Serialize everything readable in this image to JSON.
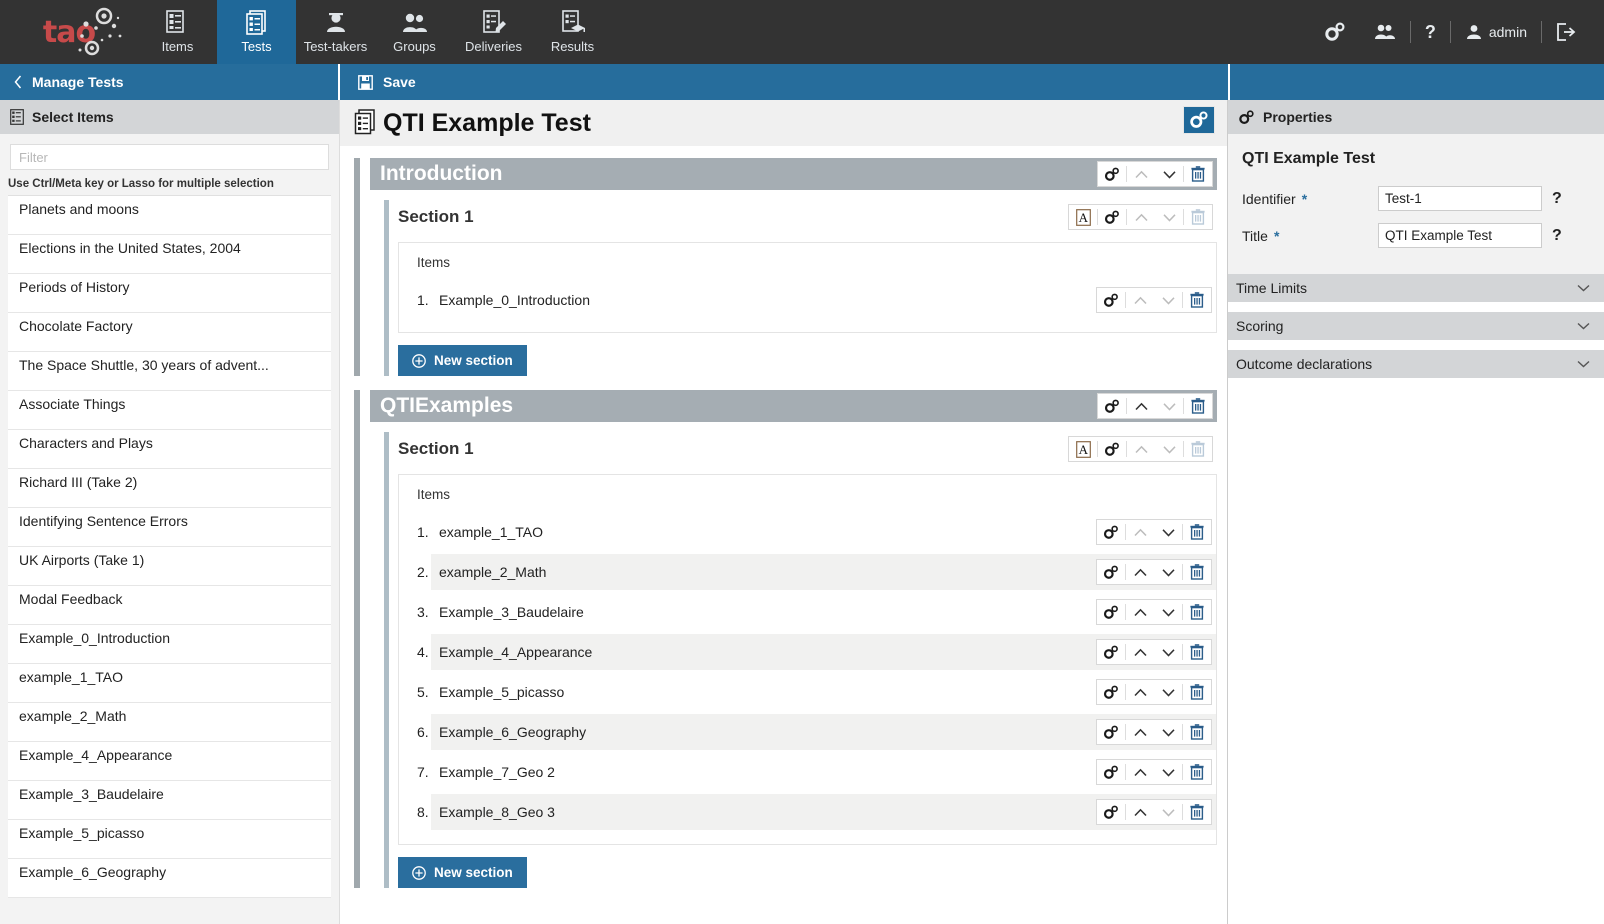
{
  "topnav": {
    "brand": "tao",
    "items": [
      {
        "label": "Items",
        "icon": "items-icon",
        "active": false
      },
      {
        "label": "Tests",
        "icon": "tests-icon",
        "active": true
      },
      {
        "label": "Test-takers",
        "icon": "testtakers-icon",
        "active": false
      },
      {
        "label": "Groups",
        "icon": "groups-icon",
        "active": false
      },
      {
        "label": "Deliveries",
        "icon": "deliveries-icon",
        "active": false
      },
      {
        "label": "Results",
        "icon": "results-icon",
        "active": false
      }
    ],
    "right": {
      "settings_icon": "gears-icon",
      "users_icon": "users-icon",
      "help_label": "?",
      "user_label": "admin",
      "logout_icon": "logout-icon"
    },
    "active_color": "#1f6899",
    "bg_color": "#333333"
  },
  "subbar": {
    "back_label": "Manage Tests",
    "save_label": "Save",
    "bg_color": "#266d9c"
  },
  "sidebar": {
    "header": "Select Items",
    "filter_placeholder": "Filter",
    "filter_value": "",
    "hint": "Use Ctrl/Meta key or Lasso for multiple selection",
    "items": [
      {
        "label": "Planets and moons"
      },
      {
        "label": "Elections in the United States, 2004"
      },
      {
        "label": "Periods of History"
      },
      {
        "label": "Chocolate Factory"
      },
      {
        "label": "The Space Shuttle, 30 years of advent..."
      },
      {
        "label": "Associate Things"
      },
      {
        "label": "Characters and Plays"
      },
      {
        "label": "Richard III (Take 2)"
      },
      {
        "label": "Identifying Sentence Errors"
      },
      {
        "label": "UK Airports (Take 1)"
      },
      {
        "label": "Modal Feedback"
      },
      {
        "label": "Example_0_Introduction"
      },
      {
        "label": "example_1_TAO"
      },
      {
        "label": "example_2_Math"
      },
      {
        "label": "Example_4_Appearance"
      },
      {
        "label": "Example_3_Baudelaire"
      },
      {
        "label": "Example_5_picasso"
      },
      {
        "label": "Example_6_Geography"
      }
    ]
  },
  "test": {
    "title": "QTI Example Test",
    "title_icon": "test-icon",
    "settings_icon": "gears-icon",
    "new_section_label": "New section",
    "items_label": "Items",
    "parts": [
      {
        "title": "Introduction",
        "toolbar": {
          "gear": true,
          "up": false,
          "down": true,
          "delete": true
        },
        "sections": [
          {
            "title": "Section 1",
            "toolbar": {
              "rubric": true,
              "gear": true,
              "up": false,
              "down": false,
              "delete": false
            },
            "items": [
              {
                "index": "1.",
                "label": "Example_0_Introduction",
                "up": false,
                "down": false,
                "delete": true
              }
            ]
          }
        ]
      },
      {
        "title": "QTIExamples",
        "toolbar": {
          "gear": true,
          "up": true,
          "down": false,
          "delete": true
        },
        "sections": [
          {
            "title": "Section 1",
            "toolbar": {
              "rubric": true,
              "gear": true,
              "up": false,
              "down": false,
              "delete": false
            },
            "items": [
              {
                "index": "1.",
                "label": "example_1_TAO",
                "up": false,
                "down": true,
                "delete": true
              },
              {
                "index": "2.",
                "label": "example_2_Math",
                "up": true,
                "down": true,
                "delete": true
              },
              {
                "index": "3.",
                "label": "Example_3_Baudelaire",
                "up": true,
                "down": true,
                "delete": true
              },
              {
                "index": "4.",
                "label": "Example_4_Appearance",
                "up": true,
                "down": true,
                "delete": true
              },
              {
                "index": "5.",
                "label": "Example_5_picasso",
                "up": true,
                "down": true,
                "delete": true
              },
              {
                "index": "6.",
                "label": "Example_6_Geography",
                "up": true,
                "down": true,
                "delete": true
              },
              {
                "index": "7.",
                "label": "Example_7_Geo 2",
                "up": true,
                "down": true,
                "delete": true
              },
              {
                "index": "8.",
                "label": "Example_8_Geo 3",
                "up": true,
                "down": false,
                "delete": true
              }
            ]
          }
        ]
      }
    ]
  },
  "properties": {
    "header": "Properties",
    "header_icon": "gears-icon",
    "test_name": "QTI Example Test",
    "fields": [
      {
        "label": "Identifier",
        "required": "*",
        "value": "Test-1",
        "help": "?"
      },
      {
        "label": "Title",
        "required": "*",
        "value": "QTI Example Test",
        "help": "?"
      }
    ],
    "accordions": [
      {
        "label": "Time Limits"
      },
      {
        "label": "Scoring"
      },
      {
        "label": "Outcome declarations"
      }
    ]
  }
}
